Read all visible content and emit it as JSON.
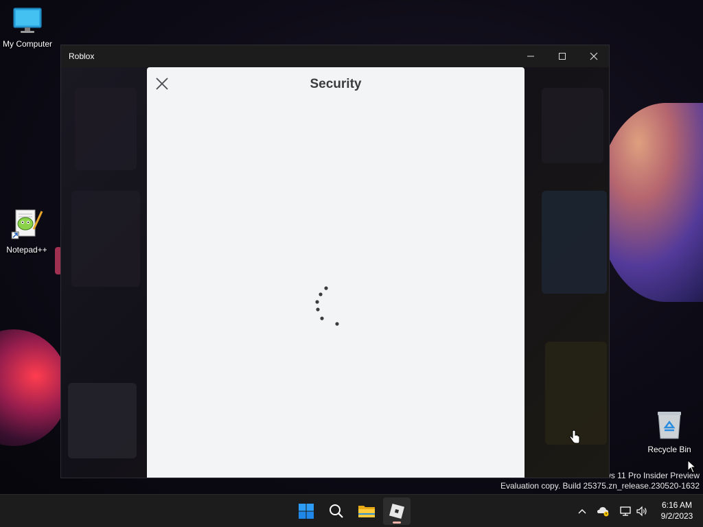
{
  "desktop": {
    "icons": [
      {
        "label": "My Computer",
        "icon": "monitor-icon"
      },
      {
        "label": "Notepad++",
        "icon": "notepad-plus-plus-icon"
      },
      {
        "label": "Recycle Bin",
        "icon": "recycle-bin-icon"
      }
    ],
    "watermark": {
      "line1": "ws 11 Pro Insider Preview",
      "line2": "Evaluation copy. Build 25375.zn_release.230520-1632"
    }
  },
  "window": {
    "title": "Roblox",
    "controls": [
      "minimize-icon",
      "maximize-icon",
      "close-icon"
    ]
  },
  "dialog": {
    "title": "Security",
    "close_icon": "close-icon",
    "state": "loading"
  },
  "taskbar": {
    "apps": [
      "start-icon",
      "search-icon",
      "file-explorer-icon",
      "roblox-icon"
    ],
    "active_app": "roblox-icon",
    "tray": [
      "chevron-up-icon",
      "onedrive-warning-icon",
      "network-icon",
      "volume-icon"
    ],
    "time": "6:16 AM",
    "date": "9/2/2023"
  },
  "colors": {
    "dialog_bg": "#f2f4f5",
    "dialog_text": "#393b3d",
    "titlebar_bg": "#1c1c1c",
    "taskbar_bg": "#1c1c1c",
    "start_blue": "#1e90ff",
    "active_indicator": "#f4b2a8"
  }
}
